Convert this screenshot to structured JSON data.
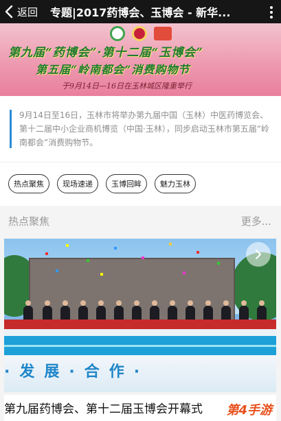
{
  "nav": {
    "back_label": "返回",
    "title": "专题|2017药博会、玉博会 - 新华..."
  },
  "banner": {
    "line1": "第九届“药博会”·第十二届“玉博会”",
    "line2": "第五届“岭南都会”消费购物节",
    "line3": "于9月14日—16日在玉林城区隆重举行"
  },
  "intro": {
    "text": "9月14日至16日，玉林市将举办第九届中国（玉林）中医药博览会、第十二届中小企业商机博览（中国·玉林），同步启动玉林市第五届“岭南都会”消费购物节。"
  },
  "tags": [
    "热点聚焦",
    "现场速递",
    "玉博回眸",
    "魅力玉林"
  ],
  "section": {
    "title": "热点聚焦",
    "more_label": "更多..."
  },
  "photo": {
    "slogan": "·发展·合作·"
  },
  "caption": {
    "text": "第九届药博会、第十二届玉博会开幕式",
    "watermark": "第4手游"
  },
  "colors": {
    "topbar_bg": "#161616",
    "intro_accent": "#2d8bd6",
    "text_muted": "#8e8e8e",
    "watermark": "#e8501c"
  },
  "icons": [
    "chevron-left-icon",
    "more-dots-icon",
    "chevron-right-icon"
  ]
}
